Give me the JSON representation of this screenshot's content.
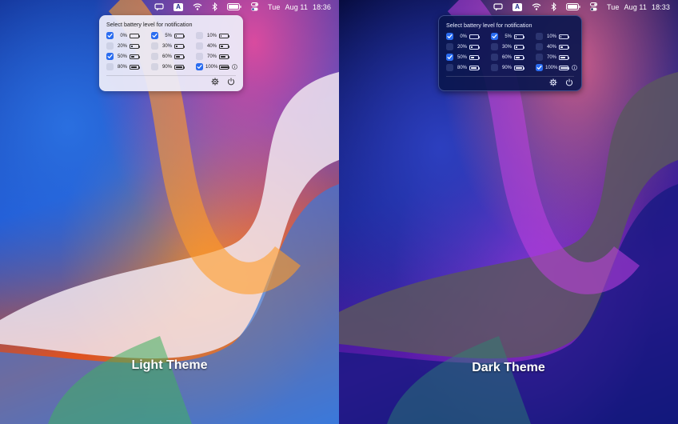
{
  "panels": [
    {
      "theme": "light",
      "caption": "Light Theme",
      "menubar": {
        "day": "Tue",
        "date": "Aug 11",
        "time": "18:36",
        "input_source": "A"
      },
      "popover": {
        "title": "Select battery level for notification",
        "options": [
          {
            "label": "0%",
            "checked": true,
            "level": 0
          },
          {
            "label": "5%",
            "checked": true,
            "level": 5
          },
          {
            "label": "10%",
            "checked": false,
            "level": 10
          },
          {
            "label": "20%",
            "checked": false,
            "level": 20
          },
          {
            "label": "30%",
            "checked": false,
            "level": 30
          },
          {
            "label": "40%",
            "checked": false,
            "level": 40
          },
          {
            "label": "50%",
            "checked": true,
            "level": 50
          },
          {
            "label": "60%",
            "checked": false,
            "level": 60
          },
          {
            "label": "70%",
            "checked": false,
            "level": 70
          },
          {
            "label": "80%",
            "checked": false,
            "level": 80
          },
          {
            "label": "90%",
            "checked": false,
            "level": 90
          },
          {
            "label": "100%",
            "checked": true,
            "level": 100
          }
        ]
      }
    },
    {
      "theme": "dark",
      "caption": "Dark Theme",
      "menubar": {
        "day": "Tue",
        "date": "Aug 11",
        "time": "18:33",
        "input_source": "A"
      },
      "popover": {
        "title": "Select battery level for notification",
        "options": [
          {
            "label": "0%",
            "checked": true,
            "level": 0
          },
          {
            "label": "5%",
            "checked": true,
            "level": 5
          },
          {
            "label": "10%",
            "checked": false,
            "level": 10
          },
          {
            "label": "20%",
            "checked": false,
            "level": 20
          },
          {
            "label": "30%",
            "checked": false,
            "level": 30
          },
          {
            "label": "40%",
            "checked": false,
            "level": 40
          },
          {
            "label": "50%",
            "checked": true,
            "level": 50
          },
          {
            "label": "60%",
            "checked": false,
            "level": 60
          },
          {
            "label": "70%",
            "checked": false,
            "level": 70
          },
          {
            "label": "80%",
            "checked": false,
            "level": 80
          },
          {
            "label": "90%",
            "checked": false,
            "level": 90
          },
          {
            "label": "100%",
            "checked": true,
            "level": 100
          }
        ]
      }
    }
  ],
  "icons": [
    "message-icon",
    "input-source-icon",
    "wifi-icon",
    "bluetooth-icon",
    "battery-icon",
    "control-center-icon",
    "info-icon",
    "gear-icon",
    "power-icon"
  ],
  "colors": {
    "accent": "#2a6cf0",
    "light_popover": "#eeeefa",
    "dark_popover": "#0a164e"
  }
}
